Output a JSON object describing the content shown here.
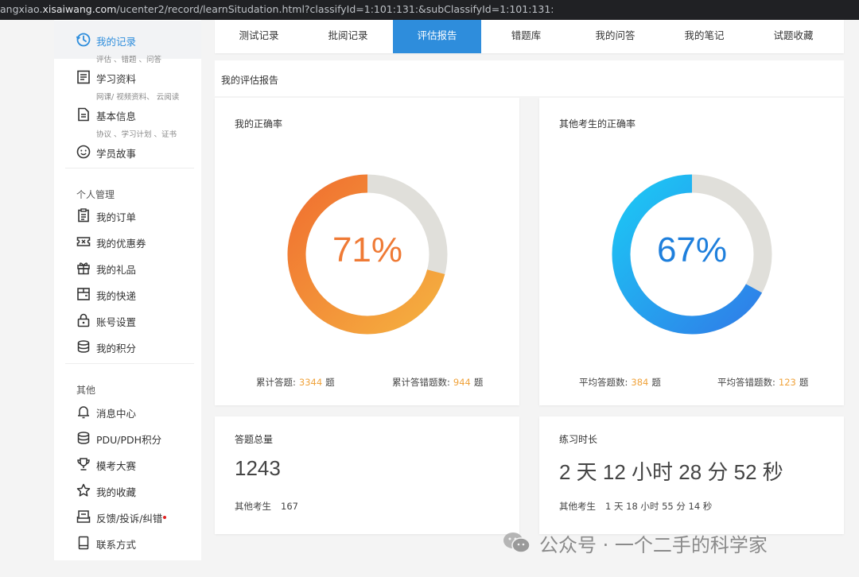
{
  "browser": {
    "url_prefix": "angxiao.",
    "url_host": "xisaiwang.com",
    "url_rest": "/ucenter2/record/learnSitudation.html?classifyId=1:101:131:&subClassifyId=1:101:131:"
  },
  "sidebar": {
    "primary": [
      {
        "label": "我的记录",
        "sub": "评估 、错题 、问答",
        "icon": "clock-history-icon"
      },
      {
        "label": "学习资料",
        "sub": "网课/ 视频资料、 云阅读",
        "icon": "document-list-icon"
      },
      {
        "label": "基本信息",
        "sub": "协议 、学习计划 、证书",
        "icon": "file-info-icon"
      },
      {
        "label": "学员故事",
        "icon": "smile-face-icon"
      }
    ],
    "personal_title": "个人管理",
    "personal": [
      {
        "label": "我的订单",
        "icon": "clipboard-icon"
      },
      {
        "label": "我的优惠券",
        "icon": "coupon-icon"
      },
      {
        "label": "我的礼品",
        "icon": "gift-icon"
      },
      {
        "label": "我的快递",
        "icon": "package-icon"
      },
      {
        "label": "账号设置",
        "icon": "lock-icon"
      },
      {
        "label": "我的积分",
        "icon": "coins-stack-icon"
      }
    ],
    "other_title": "其他",
    "other": [
      {
        "label": "消息中心",
        "icon": "bell-icon"
      },
      {
        "label": "PDU/PDH积分",
        "icon": "coins-stack-icon"
      },
      {
        "label": "模考大赛",
        "icon": "trophy-icon"
      },
      {
        "label": "我的收藏",
        "icon": "star-icon"
      },
      {
        "label": "反馈/投诉/纠错",
        "icon": "feedback-icon",
        "badge_color": "#e02020"
      },
      {
        "label": "联系方式",
        "icon": "phone-icon"
      }
    ]
  },
  "tabs": [
    "测试记录",
    "批阅记录",
    "评估报告",
    "错题库",
    "我的问答",
    "我的笔记",
    "试题收藏"
  ],
  "active_tab": 2,
  "report_title": "我的评估报告",
  "my_accuracy": {
    "title": "我的正确率",
    "percent_label": "71%",
    "percent": 71,
    "stat1_label": "累计答题:",
    "stat1_value": "3344",
    "stat1_unit": "题",
    "stat2_label": "累计答错题数:",
    "stat2_value": "944",
    "stat2_unit": "题"
  },
  "others_accuracy": {
    "title": "其他考生的正确率",
    "percent_label": "67%",
    "percent": 67,
    "stat1_label": "平均答题数:",
    "stat1_value": "384",
    "stat1_unit": "题",
    "stat2_label": "平均答错题数:",
    "stat2_value": "123",
    "stat2_unit": "题"
  },
  "total": {
    "title": "答题总量",
    "value": "1243",
    "others_label": "其他考生",
    "others_value": "167"
  },
  "duration": {
    "title": "练习时长",
    "value": "2 天 12 小时 28 分 52 秒",
    "others_label": "其他考生",
    "others_value": "1 天 18 小时 55 分 14 秒"
  },
  "watermark": "公众号 · 一个二手的科学家",
  "colors": {
    "accent": "#2e8ddc",
    "orange_start": "#f07030",
    "orange_end": "#f5b040",
    "blue_start": "#1cc8f5",
    "blue_end": "#2f7ee8",
    "ring_bg": "#e0dfda",
    "stat_value": "#f0a33c"
  }
}
